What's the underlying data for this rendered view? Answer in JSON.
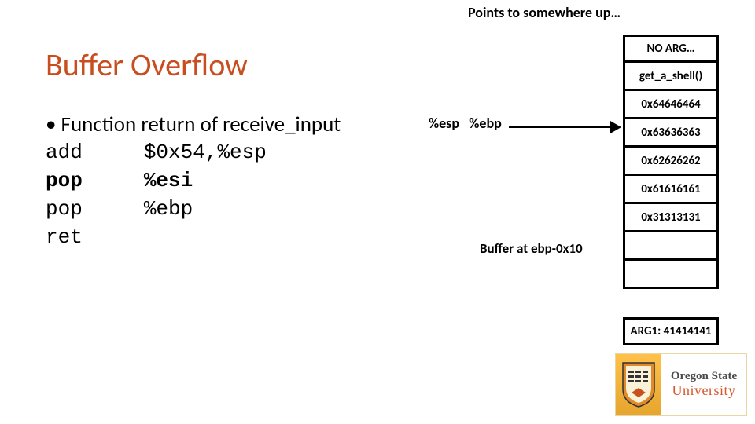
{
  "top_note": "Points to somewhere up…",
  "title": "Buffer Overflow",
  "bullet": "• Function return of receive_input",
  "asm": {
    "r1_op": "add",
    "r1_arg": "$0x54,%esp",
    "r2_op": "pop",
    "r2_arg": "%esi",
    "r3_op": "pop",
    "r3_arg": "%ebp",
    "r4_op": "ret"
  },
  "esp_label": "%esp",
  "ebp_label": "%ebp",
  "buffer_label": "Buffer at ebp-0x10",
  "stack": {
    "c0": "NO ARG…",
    "c1": "get_a_shell()",
    "c2": "0x64646464",
    "c3": "0x63636363",
    "c4": "0x62626262",
    "c5": "0x61616161",
    "c6": "0x31313131",
    "c7": "",
    "c8": ""
  },
  "arg1": "ARG1: 41414141",
  "logo": {
    "l1": "Oregon State",
    "l2": "University"
  }
}
